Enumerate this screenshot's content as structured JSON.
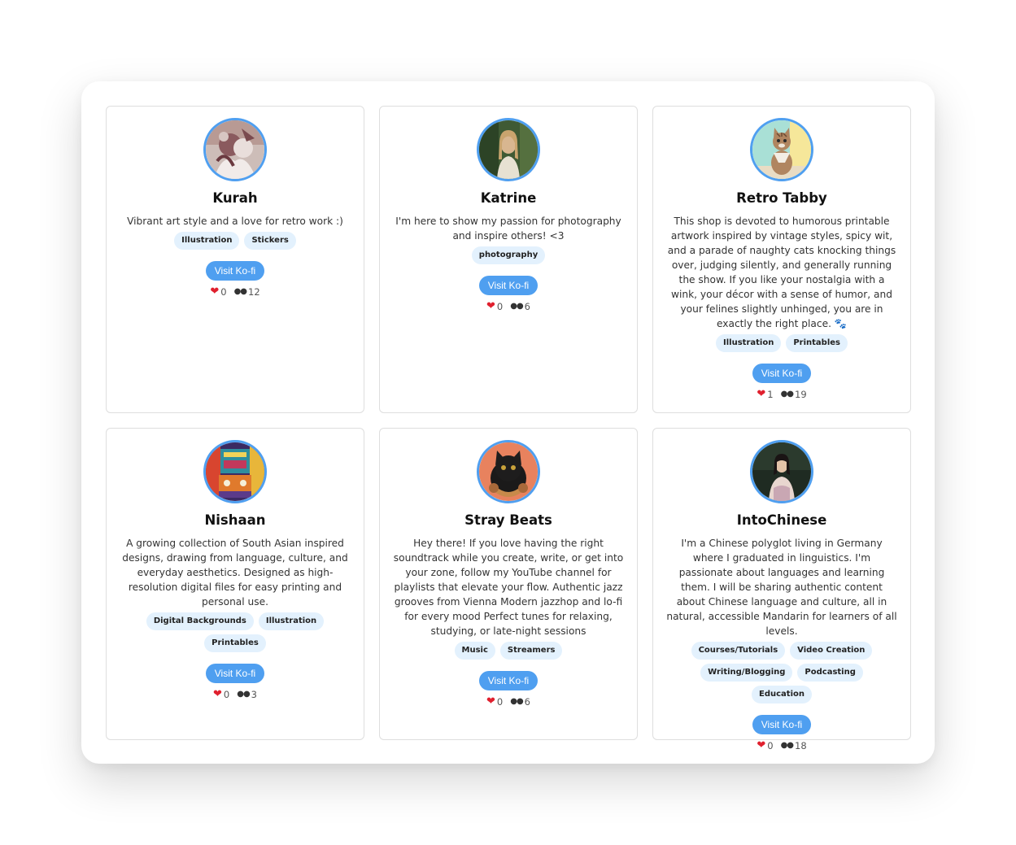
{
  "cards": [
    {
      "name": "Kurah",
      "description": "Vibrant art style and a love for retro work :)",
      "tags": [
        "Illustration",
        "Stickers"
      ],
      "button_label": "Visit Ko-fi",
      "likes": "0",
      "views": "12",
      "avatar_icon": "illustration-avatar"
    },
    {
      "name": "Katrine",
      "description": "I'm here to show my passion for photography and inspire others! <3",
      "tags": [
        "photography"
      ],
      "button_label": "Visit Ko-fi",
      "likes": "0",
      "views": "6",
      "avatar_icon": "portrait-photo-avatar"
    },
    {
      "name": "Retro Tabby",
      "description": "This shop is devoted to humorous printable artwork inspired by vintage styles, spicy wit, and a parade of naughty cats knocking things over, judging silently, and generally running the show. If you like your nostalgia with a wink, your décor with a sense of humor, and your felines slightly unhinged, you are in exactly the right place. 🐾",
      "tags": [
        "Illustration",
        "Printables"
      ],
      "button_label": "Visit Ko-fi",
      "likes": "1",
      "views": "19",
      "avatar_icon": "tabby-cat-avatar"
    },
    {
      "name": "Nishaan",
      "description": "A growing collection of South Asian inspired designs, drawing from language, culture, and everyday aesthetics. Designed as high-resolution digital files for easy printing and personal use.",
      "tags": [
        "Digital Backgrounds",
        "Illustration",
        "Printables"
      ],
      "button_label": "Visit Ko-fi",
      "likes": "0",
      "views": "3",
      "avatar_icon": "decorated-truck-avatar"
    },
    {
      "name": "Stray Beats",
      "description": "Hey there! If you love having the right soundtrack while you create, write, or get into your zone, follow my YouTube channel for playlists that elevate your flow. Authentic jazz grooves from Vienna Modern jazzhop and lo-fi for every mood Perfect tunes for relaxing, studying, or late-night sessions",
      "tags": [
        "Music",
        "Streamers"
      ],
      "button_label": "Visit Ko-fi",
      "likes": "0",
      "views": "6",
      "avatar_icon": "black-cat-headphones-avatar"
    },
    {
      "name": "IntoChinese",
      "description": "I'm a Chinese polyglot living in Germany where I graduated in linguistics. I'm passionate about languages and learning them. I will be sharing authentic content about Chinese language and culture, all in natural, accessible Mandarin for learners of all levels.",
      "tags": [
        "Courses/Tutorials",
        "Video Creation",
        "Writing/Blogging",
        "Podcasting",
        "Education"
      ],
      "button_label": "Visit Ko-fi",
      "likes": "0",
      "views": "18",
      "avatar_icon": "woman-portrait-avatar"
    }
  ],
  "colors": {
    "accent": "#4f9ff0",
    "tag_bg": "#e3f1fd",
    "heart": "#e0202e"
  }
}
